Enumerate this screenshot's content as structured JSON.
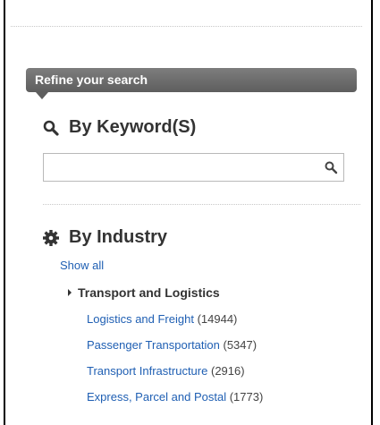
{
  "refine": {
    "title": "Refine your search"
  },
  "keyword": {
    "title": "By Keyword(S)",
    "search_value": "",
    "search_placeholder": ""
  },
  "industry": {
    "title": "By Industry",
    "show_all": "Show all",
    "category": "Transport and Logistics",
    "items": [
      {
        "label": "Logistics and Freight",
        "count": "(14944)"
      },
      {
        "label": "Passenger Transportation",
        "count": "(5347)"
      },
      {
        "label": "Transport Infrastructure",
        "count": "(2916)"
      },
      {
        "label": "Express, Parcel and Postal",
        "count": "(1773)"
      }
    ]
  },
  "colors": {
    "banner": "#666666",
    "link": "#1f5fb3",
    "heading": "#333333"
  },
  "icons": {
    "keyword": "search-icon",
    "industry": "gear-icon",
    "search_button": "search-icon"
  }
}
